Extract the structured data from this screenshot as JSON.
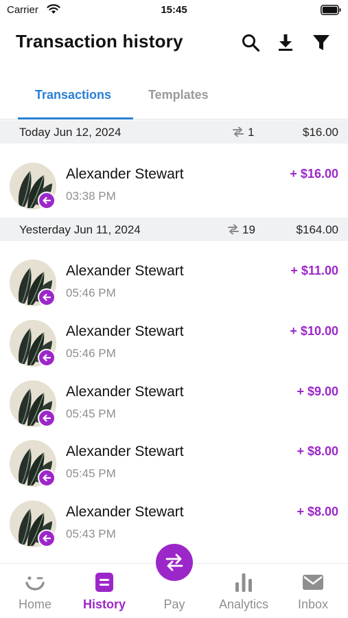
{
  "status_bar": {
    "carrier": "Carrier",
    "time": "15:45"
  },
  "header": {
    "title": "Transaction history",
    "actions": [
      "search-icon",
      "download-icon",
      "filter-icon"
    ]
  },
  "tabs": [
    {
      "label": "Transactions",
      "active": true
    },
    {
      "label": "Templates",
      "active": false
    }
  ],
  "groups": [
    {
      "date": "Today Jun 12, 2024",
      "count": "1",
      "total": "$16.00",
      "transactions": [
        {
          "name": "Alexander Stewart",
          "time": "03:38 PM",
          "amount": "+ $16.00"
        }
      ]
    },
    {
      "date": "Yesterday Jun 11, 2024",
      "count": "19",
      "total": "$164.00",
      "transactions": [
        {
          "name": "Alexander Stewart",
          "time": "05:46 PM",
          "amount": "+ $11.00"
        },
        {
          "name": "Alexander Stewart",
          "time": "05:46 PM",
          "amount": "+ $10.00"
        },
        {
          "name": "Alexander Stewart",
          "time": "05:45 PM",
          "amount": "+ $9.00"
        },
        {
          "name": "Alexander Stewart",
          "time": "05:45 PM",
          "amount": "+ $8.00"
        },
        {
          "name": "Alexander Stewart",
          "time": "05:43 PM",
          "amount": "+ $8.00"
        }
      ]
    }
  ],
  "bottom_nav": [
    {
      "label": "Home",
      "icon": "smile-icon",
      "active": false
    },
    {
      "label": "History",
      "icon": "history-icon",
      "active": true
    },
    {
      "label": "Pay",
      "icon": "transfer-icon",
      "active": false
    },
    {
      "label": "Analytics",
      "icon": "bar-chart-icon",
      "active": false
    },
    {
      "label": "Inbox",
      "icon": "mail-icon",
      "active": false
    }
  ],
  "colors": {
    "accent": "#9c27c9",
    "tab_active": "#2a7fd4",
    "group_bg": "#f0f1f3"
  }
}
